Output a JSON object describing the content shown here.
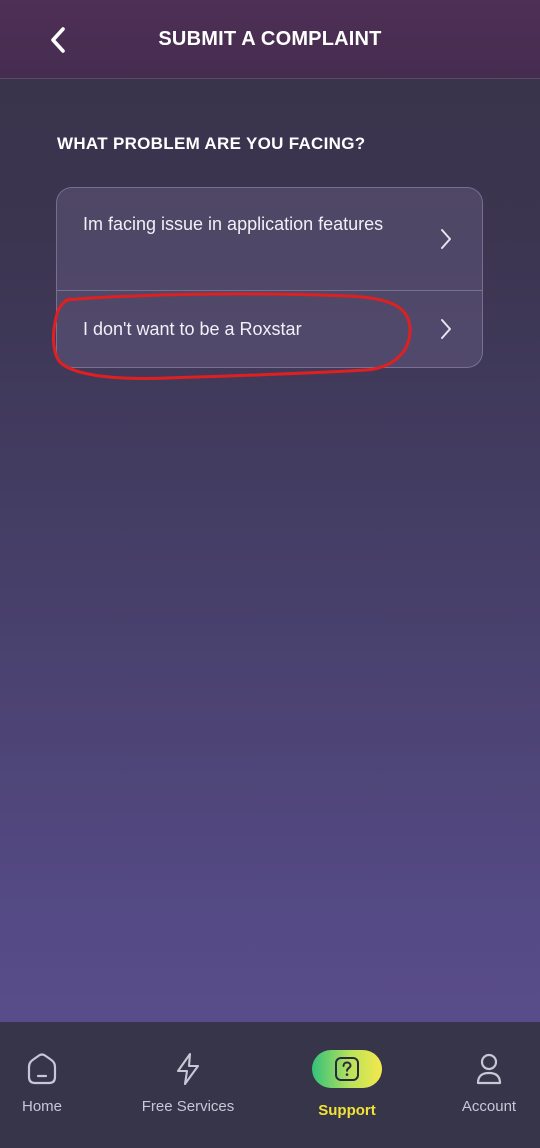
{
  "header": {
    "title": "SUBMIT A COMPLAINT",
    "back_icon": "chevron-left-icon"
  },
  "main": {
    "question": "WHAT PROBLEM ARE YOU FACING?",
    "options": [
      {
        "label": "Im facing issue in application features",
        "icon": "chevron-right-icon"
      },
      {
        "label": "I don't want to be a Roxstar",
        "icon": "chevron-right-icon"
      }
    ],
    "annotation_color": "#e02020"
  },
  "bottom_nav": {
    "items": [
      {
        "label": "Home",
        "icon": "home-icon"
      },
      {
        "label": "Free Services",
        "icon": "lightning-icon"
      },
      {
        "label": "Support",
        "icon": "question-icon",
        "active": true
      },
      {
        "label": "Account",
        "icon": "user-icon"
      }
    ],
    "active_color": "#f4e336"
  }
}
